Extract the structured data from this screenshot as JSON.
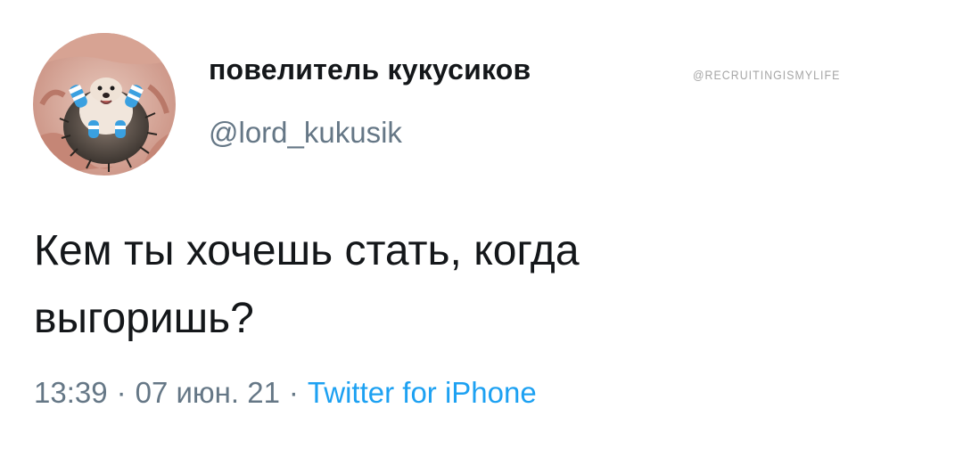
{
  "tweet": {
    "display_name": "повелитель кукусиков",
    "handle": "@lord_kukusik",
    "text_line1": "Кем ты хочешь стать, когда",
    "text_line2": "выгоришь?",
    "time": "13:39",
    "separator": "·",
    "date": "07 июн. 21",
    "source": "Twitter for iPhone"
  },
  "watermark": "@RECRUITINGISMYLIFE",
  "avatar": {
    "icon": "hedgehog-avatar-icon"
  },
  "colors": {
    "name": "#14171a",
    "handle": "#657786",
    "link": "#1da1f2",
    "watermark": "#a6a6a6"
  }
}
